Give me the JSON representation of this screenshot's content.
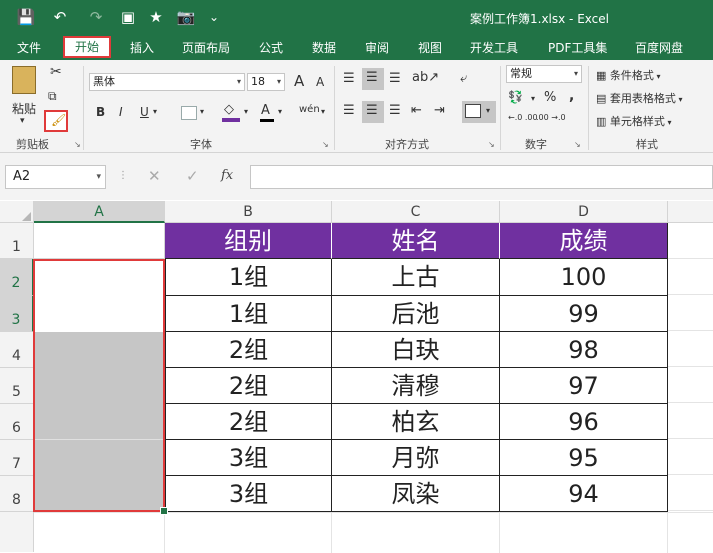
{
  "window": {
    "title": "案例工作簿1.xlsx - Excel"
  },
  "qat": {
    "save": "💾",
    "undo": "↶",
    "redo": "↷",
    "more": "⌄"
  },
  "ribbon_tabs": [
    "文件",
    "开始",
    "插入",
    "页面布局",
    "公式",
    "数据",
    "审阅",
    "视图",
    "开发工具",
    "PDF工具集",
    "百度网盘"
  ],
  "active_tab": "开始",
  "clipboard": {
    "paste_label": "粘贴",
    "group_label": "剪贴板"
  },
  "font": {
    "family": "黑体",
    "size": "18",
    "group_label": "字体",
    "bold": "B",
    "italic": "I",
    "underline": "U",
    "font_color_label": "A",
    "grow": "A",
    "shrink": "A",
    "phonetic": "wén"
  },
  "alignment": {
    "group_label": "对齐方式"
  },
  "number": {
    "format": "常规",
    "percent": "%",
    "comma": ",",
    "group_label": "数字",
    "inc_decimal": "←.0 .00",
    "dec_decimal": ".00 →.0"
  },
  "styles": {
    "conditional": "条件格式",
    "table": "套用表格格式",
    "cell": "单元格样式",
    "group_label": "样式"
  },
  "formula_bar": {
    "name_box": "A2",
    "fx": "fx",
    "cancel": "✕",
    "enter": "✓",
    "content": ""
  },
  "columns": [
    "A",
    "B",
    "C",
    "D"
  ],
  "rows": [
    "1",
    "2",
    "3",
    "4",
    "5",
    "6",
    "7",
    "8"
  ],
  "table": {
    "headers": [
      "组别",
      "姓名",
      "成绩"
    ],
    "rows": [
      [
        "1组",
        "上古",
        "100"
      ],
      [
        "1组",
        "后池",
        "99"
      ],
      [
        "2组",
        "白玦",
        "98"
      ],
      [
        "2组",
        "清穆",
        "97"
      ],
      [
        "2组",
        "柏玄",
        "96"
      ],
      [
        "3组",
        "月弥",
        "95"
      ],
      [
        "3组",
        "凤染",
        "94"
      ]
    ]
  },
  "colors": {
    "excel_green": "#217346",
    "header_purple": "#7030a0",
    "highlight_red": "#e03a3a",
    "merged_gray": "#c6c6c6"
  }
}
